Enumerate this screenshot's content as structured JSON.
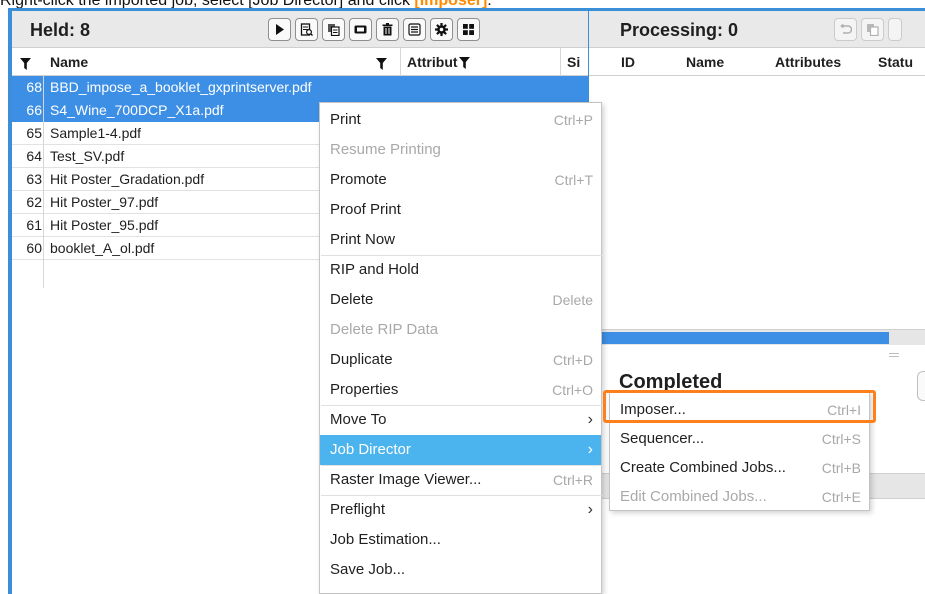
{
  "instruction": {
    "prefix": "Right-click the imported job, select [Job Director] and click ",
    "highlight": "[Imposer]",
    "suffix": "."
  },
  "held": {
    "title": "Held: 8",
    "toolbar": [
      {
        "name": "play-icon"
      },
      {
        "name": "proof-icon"
      },
      {
        "name": "copy-icon"
      },
      {
        "name": "rip-icon"
      },
      {
        "name": "trash-icon"
      },
      {
        "name": "list-icon"
      },
      {
        "name": "gear-icon"
      },
      {
        "name": "grid-icon"
      }
    ],
    "columns": {
      "name": "Name",
      "attributes": "Attribut",
      "size": "Si"
    },
    "jobs": [
      {
        "id": "68",
        "name": "BBD_impose_a_booklet_gxprintserver.pdf",
        "selected": true
      },
      {
        "id": "66",
        "name": "S4_Wine_700DCP_X1a.pdf",
        "selected": true
      },
      {
        "id": "65",
        "name": "Sample1-4.pdf",
        "selected": false
      },
      {
        "id": "64",
        "name": "Test_SV.pdf",
        "selected": false
      },
      {
        "id": "63",
        "name": "Hit Poster_Gradation.pdf",
        "selected": false
      },
      {
        "id": "62",
        "name": "Hit Poster_97.pdf",
        "selected": false
      },
      {
        "id": "61",
        "name": "Hit Poster_95.pdf",
        "selected": false
      },
      {
        "id": "60",
        "name": "booklet_A_ol.pdf",
        "selected": false
      }
    ]
  },
  "processing": {
    "title": "Processing: 0",
    "columns": {
      "id": "ID",
      "name": "Name",
      "attributes": "Attributes",
      "status": "Statu"
    }
  },
  "completed": {
    "title": "Completed"
  },
  "context_menu": {
    "items": [
      {
        "label": "Print",
        "shortcut": "Ctrl+P",
        "disabled": false
      },
      {
        "label": "Resume Printing",
        "shortcut": "",
        "disabled": true
      },
      {
        "label": "Promote",
        "shortcut": "Ctrl+T",
        "disabled": false
      },
      {
        "label": "Proof Print",
        "shortcut": "",
        "disabled": false
      },
      {
        "label": "Print Now",
        "shortcut": "",
        "disabled": false
      },
      {
        "label": "RIP and Hold",
        "shortcut": "",
        "disabled": false
      },
      {
        "label": "Delete",
        "shortcut": "Delete",
        "disabled": false
      },
      {
        "label": "Delete RIP Data",
        "shortcut": "",
        "disabled": true
      },
      {
        "label": "Duplicate",
        "shortcut": "Ctrl+D",
        "disabled": false
      },
      {
        "label": "Properties",
        "shortcut": "Ctrl+O",
        "disabled": false
      },
      {
        "label": "Move To",
        "shortcut": "",
        "disabled": false,
        "submenu": true
      },
      {
        "label": "Job Director",
        "shortcut": "",
        "disabled": false,
        "submenu": true,
        "active": true
      },
      {
        "label": "Raster Image Viewer...",
        "shortcut": "Ctrl+R",
        "disabled": false
      },
      {
        "label": "Preflight",
        "shortcut": "",
        "disabled": false,
        "submenu": true
      },
      {
        "label": "Job Estimation...",
        "shortcut": "",
        "disabled": false
      },
      {
        "label": "Save Job...",
        "shortcut": "",
        "disabled": false
      }
    ]
  },
  "submenu": {
    "items": [
      {
        "label": "Imposer...",
        "shortcut": "Ctrl+I",
        "disabled": false
      },
      {
        "label": "Sequencer...",
        "shortcut": "Ctrl+S",
        "disabled": false
      },
      {
        "label": "Create Combined Jobs...",
        "shortcut": "Ctrl+B",
        "disabled": false
      },
      {
        "label": "Edit Combined Jobs...",
        "shortcut": "Ctrl+E",
        "disabled": true
      }
    ]
  },
  "colors": {
    "frame": "#3b8fd8",
    "selection": "#3d8fe6",
    "menu_active": "#4bb3ee",
    "callout": "#ff7f1a"
  }
}
